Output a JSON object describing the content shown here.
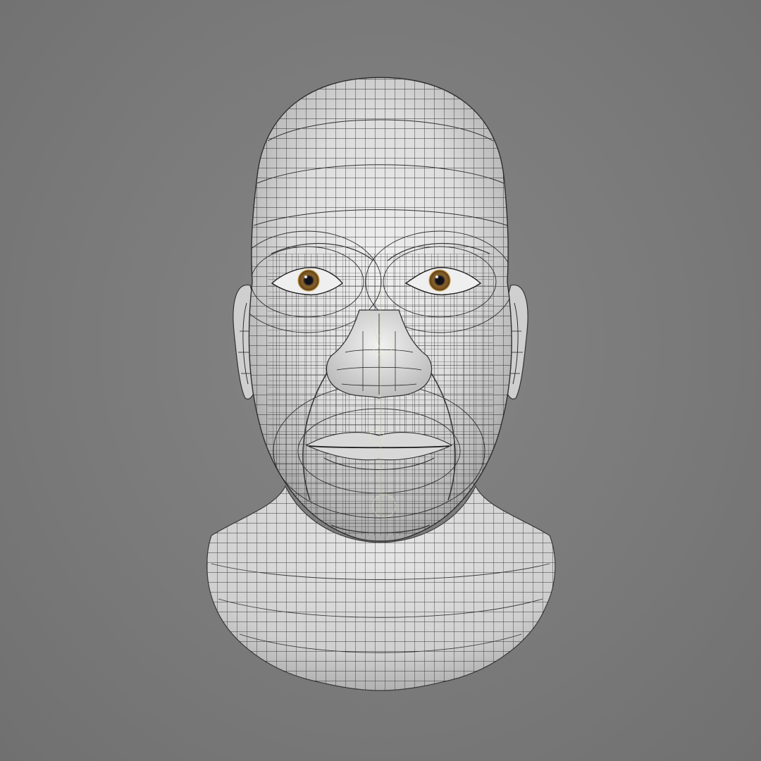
{
  "scene": {
    "subject": "head-bust-wireframe",
    "background_color": "#7b7b7b",
    "surface_color": "#e6e6e6",
    "wire_color": "#1e1e1e",
    "iris_color": "#8a6428"
  }
}
